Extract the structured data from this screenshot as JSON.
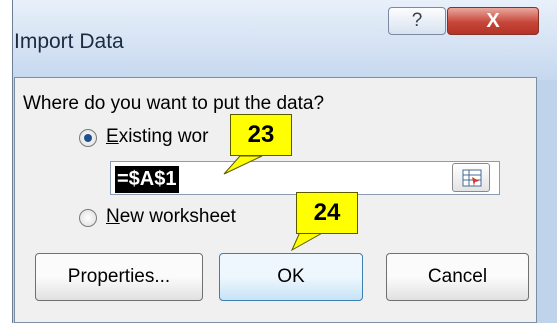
{
  "dialog": {
    "title": "Import Data",
    "help_glyph": "?",
    "close_glyph": "X",
    "prompt": "Where do you want to put the data?"
  },
  "options": {
    "existing_prefix": "E",
    "existing_rest": "xisting wor",
    "existing_tail": "",
    "new_prefix": "N",
    "new_rest": "ew worksheet"
  },
  "reference": {
    "value": "=$A$1"
  },
  "buttons": {
    "properties": "Properties...",
    "ok": "OK",
    "cancel": "Cancel"
  },
  "callouts": {
    "first": "23",
    "second": "24",
    "color": "#ffff00"
  },
  "icons": {
    "help": "question-mark-icon",
    "close": "close-icon",
    "ref_picker": "range-select-icon"
  },
  "colors": {
    "title_bar": "#c6d8ee",
    "close_button": "#c7463a",
    "dialog_body": "#f0f0f0",
    "ok_accent": "#3c7fb1"
  }
}
